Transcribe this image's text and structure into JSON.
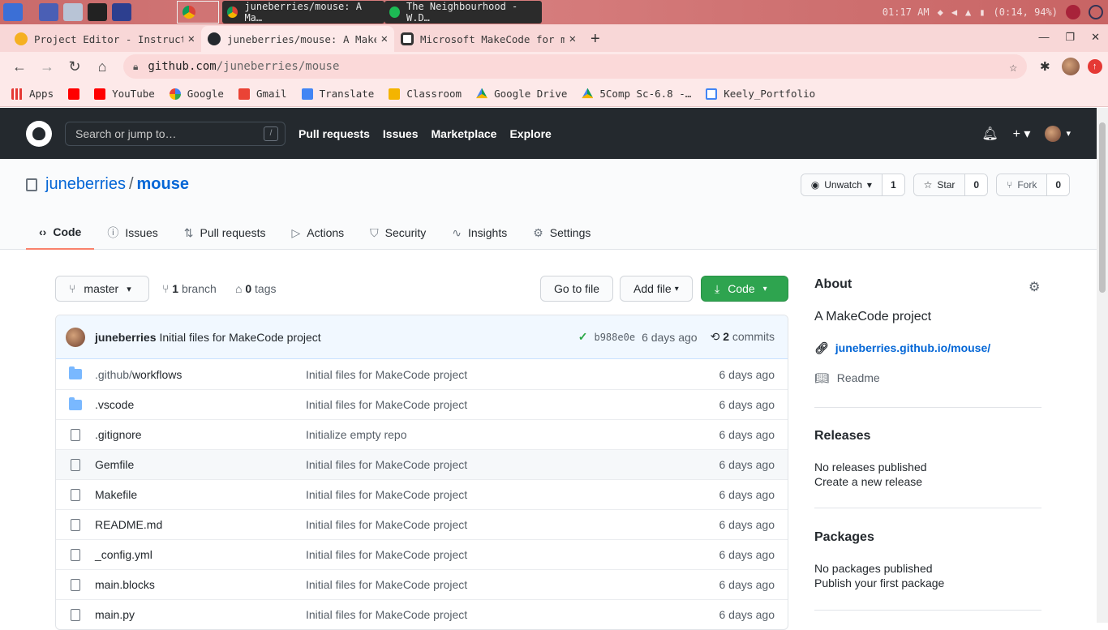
{
  "taskbar": {
    "window1": "juneberries/mouse: A Ma…",
    "window2": "The Neighbourhood - W.D…",
    "time": "01:17 AM",
    "battery": "(0:14, 94%)"
  },
  "tabs": [
    {
      "title": "Project Editor - Instruct"
    },
    {
      "title": "juneberries/mouse: A Make"
    },
    {
      "title": "Microsoft MakeCode for mi"
    }
  ],
  "address": {
    "host": "github.com",
    "path": "/juneberries/mouse"
  },
  "bookmarks": [
    "Apps",
    "YouTube",
    "Google",
    "Gmail",
    "Translate",
    "Classroom",
    "Google Drive",
    "5Comp Sc-6.8 -…",
    "Keely_Portfolio"
  ],
  "gh": {
    "search_placeholder": "Search or jump to…",
    "slash": "/",
    "nav": [
      "Pull requests",
      "Issues",
      "Marketplace",
      "Explore"
    ]
  },
  "repo": {
    "owner": "juneberries",
    "sep": "/",
    "name": "mouse",
    "unwatch": "Unwatch",
    "unwatch_count": "1",
    "star": "Star",
    "star_count": "0",
    "fork": "Fork",
    "fork_count": "0",
    "tabs": [
      "Code",
      "Issues",
      "Pull requests",
      "Actions",
      "Security",
      "Insights",
      "Settings"
    ]
  },
  "main": {
    "branch": "master",
    "branch_count": "1",
    "branch_label": "branch",
    "tag_count": "0",
    "tag_label": "tags",
    "go_to_file": "Go to file",
    "add_file": "Add file",
    "code": "Code",
    "commit": {
      "author": "juneberries",
      "message": "Initial files for MakeCode project",
      "sha": "b988e0e",
      "age": "6 days ago",
      "count": "2",
      "count_label": "commits"
    },
    "files": [
      {
        "prefix": ".github/",
        "name": "workflows",
        "msg": "Initial files for MakeCode project",
        "age": "6 days ago",
        "type": "dir"
      },
      {
        "prefix": "",
        "name": ".vscode",
        "msg": "Initial files for MakeCode project",
        "age": "6 days ago",
        "type": "dir"
      },
      {
        "prefix": "",
        "name": ".gitignore",
        "msg": "Initialize empty repo",
        "age": "6 days ago",
        "type": "file"
      },
      {
        "prefix": "",
        "name": "Gemfile",
        "msg": "Initial files for MakeCode project",
        "age": "6 days ago",
        "type": "file"
      },
      {
        "prefix": "",
        "name": "Makefile",
        "msg": "Initial files for MakeCode project",
        "age": "6 days ago",
        "type": "file"
      },
      {
        "prefix": "",
        "name": "README.md",
        "msg": "Initial files for MakeCode project",
        "age": "6 days ago",
        "type": "file"
      },
      {
        "prefix": "",
        "name": "_config.yml",
        "msg": "Initial files for MakeCode project",
        "age": "6 days ago",
        "type": "file"
      },
      {
        "prefix": "",
        "name": "main.blocks",
        "msg": "Initial files for MakeCode project",
        "age": "6 days ago",
        "type": "file"
      },
      {
        "prefix": "",
        "name": "main.py",
        "msg": "Initial files for MakeCode project",
        "age": "6 days ago",
        "type": "file"
      }
    ]
  },
  "sidebar": {
    "about": "About",
    "description": "A MakeCode project",
    "website": "juneberries.github.io/mouse/",
    "readme": "Readme",
    "releases": "Releases",
    "no_releases": "No releases published",
    "create_release": "Create a new release",
    "packages": "Packages",
    "no_packages": "No packages published",
    "publish_package": "Publish your first package"
  }
}
